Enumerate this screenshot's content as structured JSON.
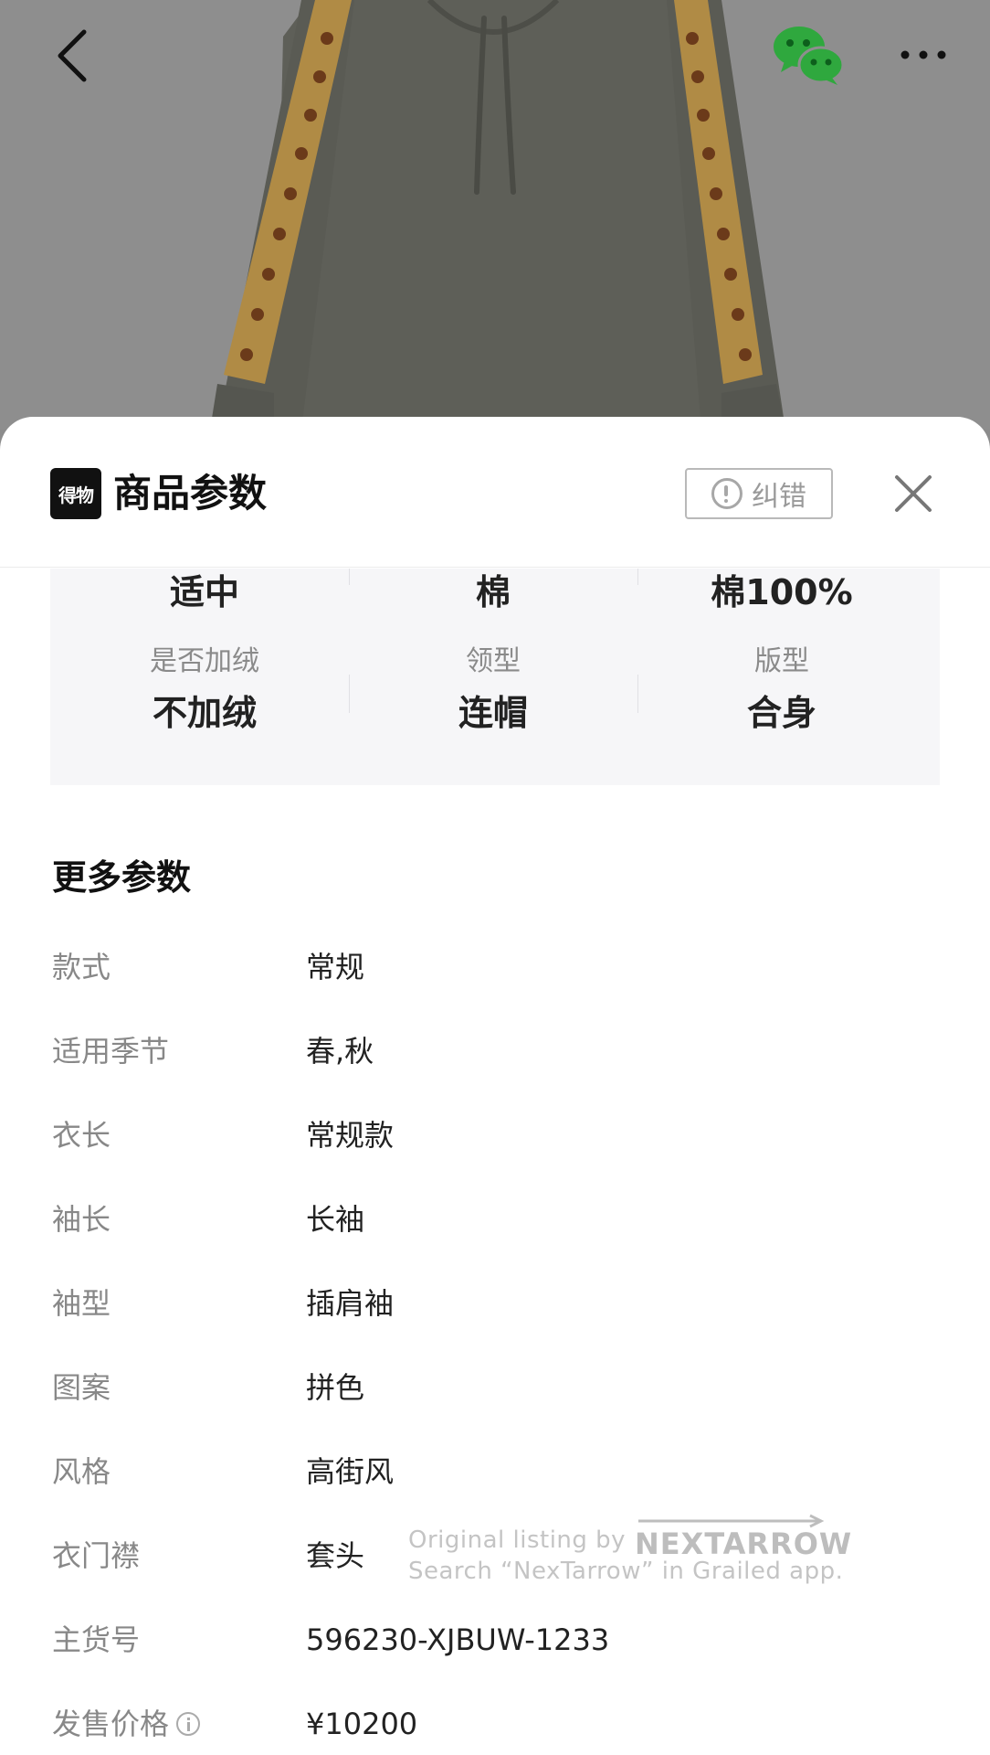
{
  "topbar": {
    "back_icon": "chevron-left-icon",
    "share_icon": "wechat-icon",
    "more_icon": "more-dots-icon"
  },
  "sheet": {
    "app_logo": "得物",
    "title": "商品参数",
    "report_label": "纠错",
    "close_icon": "close-icon"
  },
  "params": [
    {
      "label": "",
      "value": "适中"
    },
    {
      "label": "",
      "value": "棉"
    },
    {
      "label": "",
      "value": "棉100%"
    },
    {
      "label": "是否加绒",
      "value": "不加绒"
    },
    {
      "label": "领型",
      "value": "连帽"
    },
    {
      "label": "版型",
      "value": "合身"
    }
  ],
  "more": {
    "title": "更多参数",
    "rows": [
      {
        "label": "款式",
        "value": "常规"
      },
      {
        "label": "适用季节",
        "value": "春,秋"
      },
      {
        "label": "衣长",
        "value": "常规款"
      },
      {
        "label": "袖长",
        "value": "长袖"
      },
      {
        "label": "袖型",
        "value": "插肩袖"
      },
      {
        "label": "图案",
        "value": "拼色"
      },
      {
        "label": "风格",
        "value": "高街风"
      },
      {
        "label": "衣门襟",
        "value": "套头"
      },
      {
        "label": "主货号",
        "value": "596230-XJBUW-1233"
      },
      {
        "label": "发售价格",
        "value": "¥10200"
      }
    ]
  },
  "watermark": {
    "line1": "Original listing by",
    "brand": "NEXTARROW",
    "line2": "Search “NexTarrow” in Grailed app."
  },
  "colors": {
    "backdrop": "#8e8e8e",
    "hoodie": "#5f5f58",
    "stripe": "#b0873e",
    "wechat_green": "#2fa83e"
  }
}
